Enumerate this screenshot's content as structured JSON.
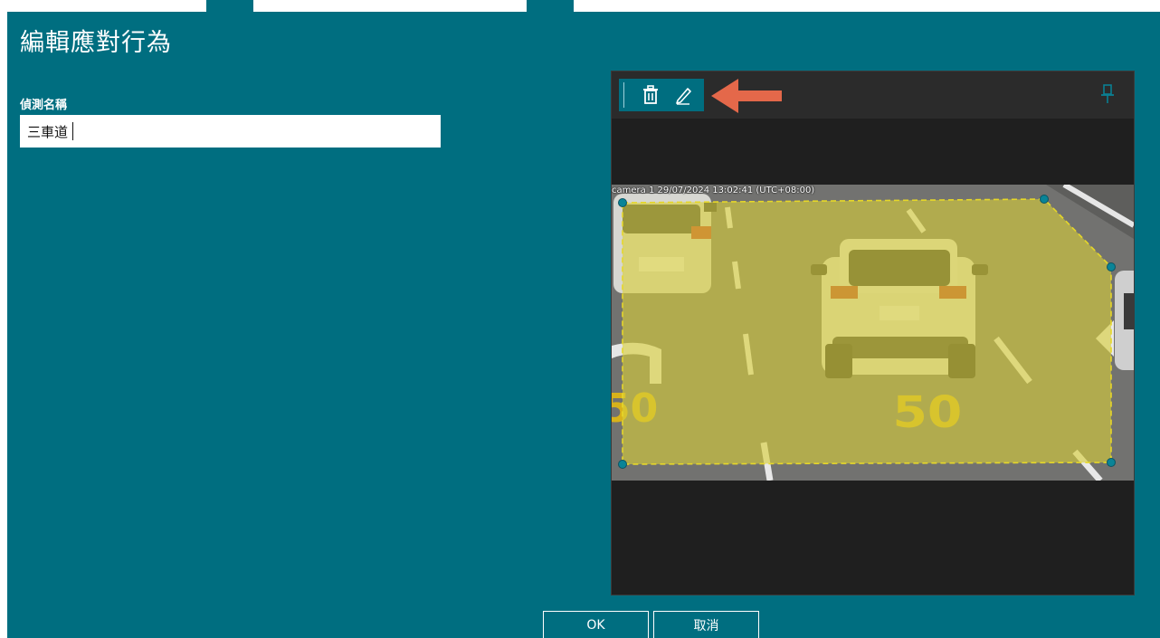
{
  "dialog": {
    "title": "編輯應對行為"
  },
  "detection_name": {
    "label": "偵測名稱",
    "value": "三車道"
  },
  "viewer": {
    "osd_text": "camera 1 29/07/2024 13:02:41 (UTC+08:00)",
    "tools": [
      "delete-icon",
      "edit-icon"
    ],
    "pin_icon": "pin-icon",
    "arrow_color": "#e4684a",
    "zone_fill_color": "#d8cf3a"
  },
  "road_marking": {
    "speed_text": "50"
  },
  "buttons": {
    "ok_label": "OK",
    "cancel_label": "取消"
  },
  "colors": {
    "accent": "#006e80"
  }
}
